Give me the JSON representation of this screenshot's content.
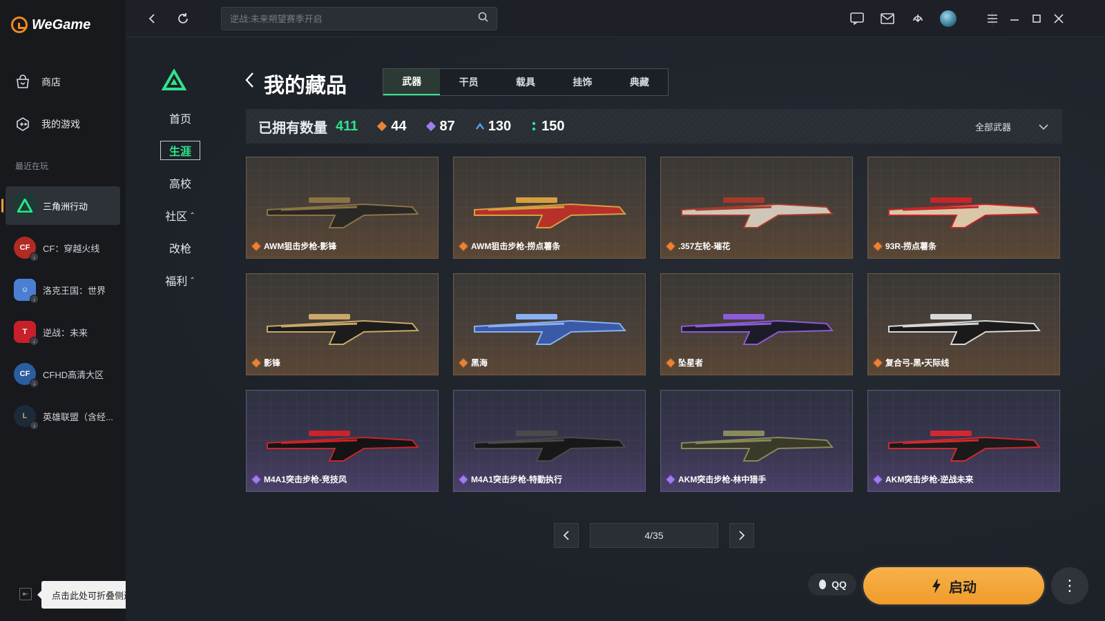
{
  "app": {
    "name": "WeGame"
  },
  "sidebar": {
    "nav": [
      {
        "label": "商店",
        "icon": "store-bag-icon"
      },
      {
        "label": "我的游戏",
        "icon": "game-tag-icon"
      }
    ],
    "recent_title": "最近在玩",
    "games": [
      {
        "label": "三角洲行动",
        "icon": "delta-force-icon",
        "color": "#1d3b32",
        "active": true
      },
      {
        "label": "CF：穿越火线",
        "icon": "cf-icon",
        "color": "#b22a24"
      },
      {
        "label": "洛克王国：世界",
        "icon": "roco-icon",
        "color": "#4a7fd4"
      },
      {
        "label": "逆战：未来",
        "icon": "nz-icon",
        "color": "#c8202a"
      },
      {
        "label": "CFHD高清大区",
        "icon": "cfhd-icon",
        "color": "#2b5e9e"
      },
      {
        "label": "英雄联盟（含经...",
        "icon": "lol-icon",
        "color": "#1c2a3a"
      }
    ],
    "collapse_tooltip": "点击此处可折叠侧边栏"
  },
  "topbar": {
    "search_placeholder": "逆战:未来朔望赛季开启"
  },
  "subnav": {
    "items": [
      {
        "label": "首页"
      },
      {
        "label": "生涯",
        "active": true
      },
      {
        "label": "高校"
      },
      {
        "label": "社区",
        "caret": "⌃"
      },
      {
        "label": "改枪"
      },
      {
        "label": "福利",
        "caret": "⌃"
      }
    ]
  },
  "page": {
    "title": "我的藏品",
    "tabs": [
      "武器",
      "干员",
      "载具",
      "挂饰",
      "典藏"
    ],
    "active_tab": "武器",
    "owned_label": "已拥有数量",
    "owned_count": "411",
    "stats": [
      {
        "value": "44",
        "color": "#e8843a"
      },
      {
        "value": "87",
        "color": "#a27cf0"
      },
      {
        "value": "130",
        "color": "#4fa6f0"
      },
      {
        "value": "150",
        "color": "#2fe38e"
      }
    ],
    "filter_label": "全部武器"
  },
  "items": [
    {
      "name": "AWM狙击步枪-影锋",
      "rarity": "orange",
      "colors": [
        "#2a2824",
        "#8a7446"
      ]
    },
    {
      "name": "AWM狙击步枪-捞点薯条",
      "rarity": "orange",
      "colors": [
        "#b8302a",
        "#d6a040"
      ]
    },
    {
      "name": ".357左轮-璀花",
      "rarity": "orange",
      "colors": [
        "#cfc6b8",
        "#a43a2a"
      ]
    },
    {
      "name": "93R-捞点薯条",
      "rarity": "orange",
      "colors": [
        "#d8c8a8",
        "#c8242a"
      ]
    },
    {
      "name": "影锋",
      "rarity": "orange",
      "colors": [
        "#1c1c1c",
        "#c9a86a"
      ]
    },
    {
      "name": "黑海",
      "rarity": "orange",
      "colors": [
        "#3a5aa8",
        "#8ab0f0"
      ]
    },
    {
      "name": "坠星者",
      "rarity": "orange",
      "colors": [
        "#1c1c28",
        "#8a5cd8"
      ]
    },
    {
      "name": "复合弓-黑•天际线",
      "rarity": "orange",
      "colors": [
        "#1a1a1a",
        "#d8d8d8"
      ]
    },
    {
      "name": "M4A1突击步枪-竞技风",
      "rarity": "purple",
      "colors": [
        "#141414",
        "#c8242a"
      ]
    },
    {
      "name": "M4A1突击步枪-特勤执行",
      "rarity": "purple",
      "colors": [
        "#181818",
        "#4a4a4a"
      ]
    },
    {
      "name": "AKM突击步枪-林中猎手",
      "rarity": "purple",
      "colors": [
        "#3a3a2a",
        "#8a8a5a"
      ]
    },
    {
      "name": "AKM突击步枪-逆战未来",
      "rarity": "purple",
      "colors": [
        "#1a1a1a",
        "#d02a30"
      ]
    }
  ],
  "pagination": {
    "current": "4/35"
  },
  "footer": {
    "qq_label": "QQ",
    "launch_label": "启动",
    "more_label": "⋮"
  }
}
